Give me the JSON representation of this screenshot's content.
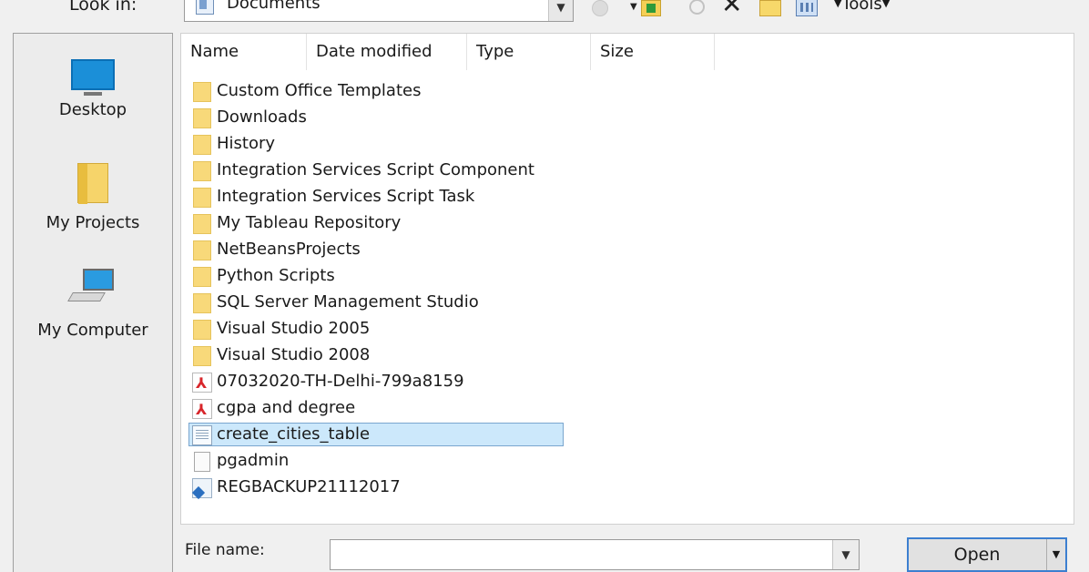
{
  "toolbar": {
    "look_in_label": "Look in:",
    "look_in_value": "Documents",
    "tools_label": "Tools",
    "icons": [
      "back-icon",
      "up-folder-icon",
      "search-web-icon",
      "delete-icon",
      "new-folder-icon",
      "views-icon"
    ]
  },
  "places": [
    {
      "label": "Desktop",
      "icon": "desktop-icon"
    },
    {
      "label": "My Projects",
      "icon": "folder-icon"
    },
    {
      "label": "My Computer",
      "icon": "computer-icon"
    }
  ],
  "columns": {
    "name": "Name",
    "date": "Date modified",
    "type": "Type",
    "size": "Size"
  },
  "files": [
    {
      "name": "Custom Office Templates",
      "icon": "folder"
    },
    {
      "name": "Downloads",
      "icon": "folder"
    },
    {
      "name": "History",
      "icon": "folder"
    },
    {
      "name": "Integration Services Script Component",
      "icon": "folder"
    },
    {
      "name": "Integration Services Script Task",
      "icon": "folder"
    },
    {
      "name": "My Tableau Repository",
      "icon": "folder"
    },
    {
      "name": "NetBeansProjects",
      "icon": "folder"
    },
    {
      "name": "Python Scripts",
      "icon": "folder"
    },
    {
      "name": "SQL Server Management Studio",
      "icon": "folder"
    },
    {
      "name": "Visual Studio 2005",
      "icon": "folder"
    },
    {
      "name": "Visual Studio 2008",
      "icon": "folder"
    },
    {
      "name": "07032020-TH-Delhi-799a8159",
      "icon": "pdf"
    },
    {
      "name": "cgpa and degree",
      "icon": "pdf"
    },
    {
      "name": "create_cities_table",
      "icon": "sql",
      "selected": true
    },
    {
      "name": "pgadmin",
      "icon": "file"
    },
    {
      "name": "REGBACKUP21112017",
      "icon": "reg"
    }
  ],
  "footer": {
    "file_name_label": "File name:",
    "file_name_value": "",
    "open_label": "Open"
  },
  "colors": {
    "selection": "#cce8fb",
    "folder": "#f8d97a",
    "accent": "#3c7fd0"
  }
}
